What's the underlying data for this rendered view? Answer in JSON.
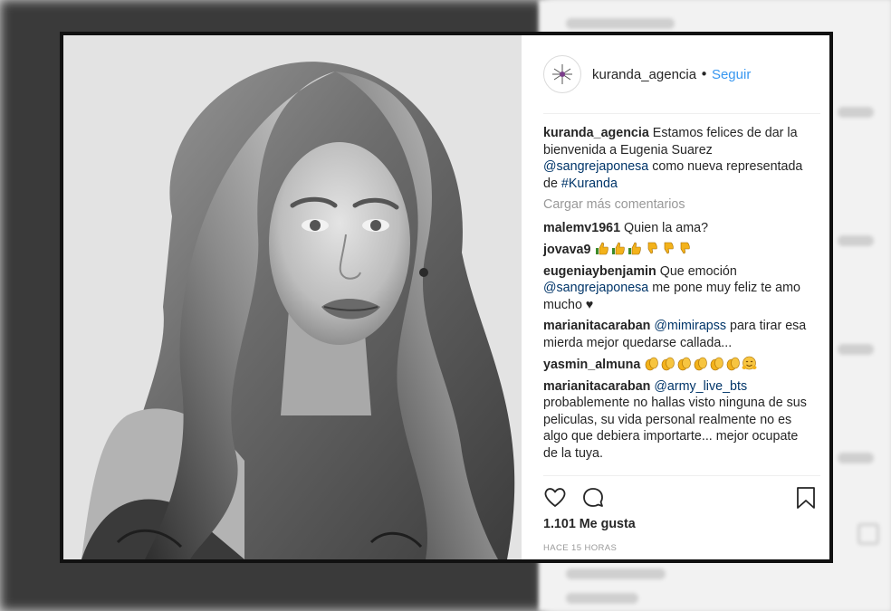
{
  "post": {
    "username": "kuranda_agencia",
    "separator": "•",
    "follow_label": "Seguir",
    "caption": {
      "user": "kuranda_agencia",
      "text": "Estamos felices de dar la bienvenida a Eugenia Suarez",
      "mention": "@sangrejaponesa",
      "text2": "como nueva representada de",
      "hashtag": "#Kuranda"
    },
    "load_more": "Cargar más comentarios",
    "comments": [
      {
        "user": "malemv1961",
        "text": "Quien la ama?"
      },
      {
        "user": "jovava9",
        "emoji": [
          "thumbs-up-icon",
          "thumbs-up-icon",
          "thumbs-up-icon",
          "thumbs-down-icon",
          "thumbs-down-icon",
          "thumbs-down-icon"
        ]
      },
      {
        "user": "eugeniaybenjamin",
        "text": "Que emoción",
        "mention": "@sangrejaponesa",
        "text2": "me pone muy feliz te amo mucho",
        "heart": "♥"
      },
      {
        "user": "marianitacaraban",
        "mention": "@mimirapss",
        "text": "para tirar esa mierda mejor quedarse callada..."
      },
      {
        "user": "yasmin_almuna",
        "emoji": [
          "clapping-hands-icon",
          "clapping-hands-icon",
          "clapping-hands-icon",
          "clapping-hands-icon",
          "clapping-hands-icon",
          "clapping-hands-icon",
          "hugging-face-icon"
        ]
      },
      {
        "user": "marianitacaraban",
        "mention": "@army_live_bts",
        "text": "probablemente no hallas visto ninguna de sus peliculas, su vida personal realmente no es algo que debiera importarte... mejor ocupate de la tuya."
      }
    ],
    "likes": "1.101 Me gusta",
    "time": "HACE 15 HORAS",
    "icons": {
      "like": "heart-outline-icon",
      "comment": "comment-bubble-icon",
      "save": "bookmark-icon"
    }
  },
  "colors": {
    "link": "#3897f0",
    "mention": "#003569",
    "muted": "#999999",
    "text": "#262626"
  }
}
